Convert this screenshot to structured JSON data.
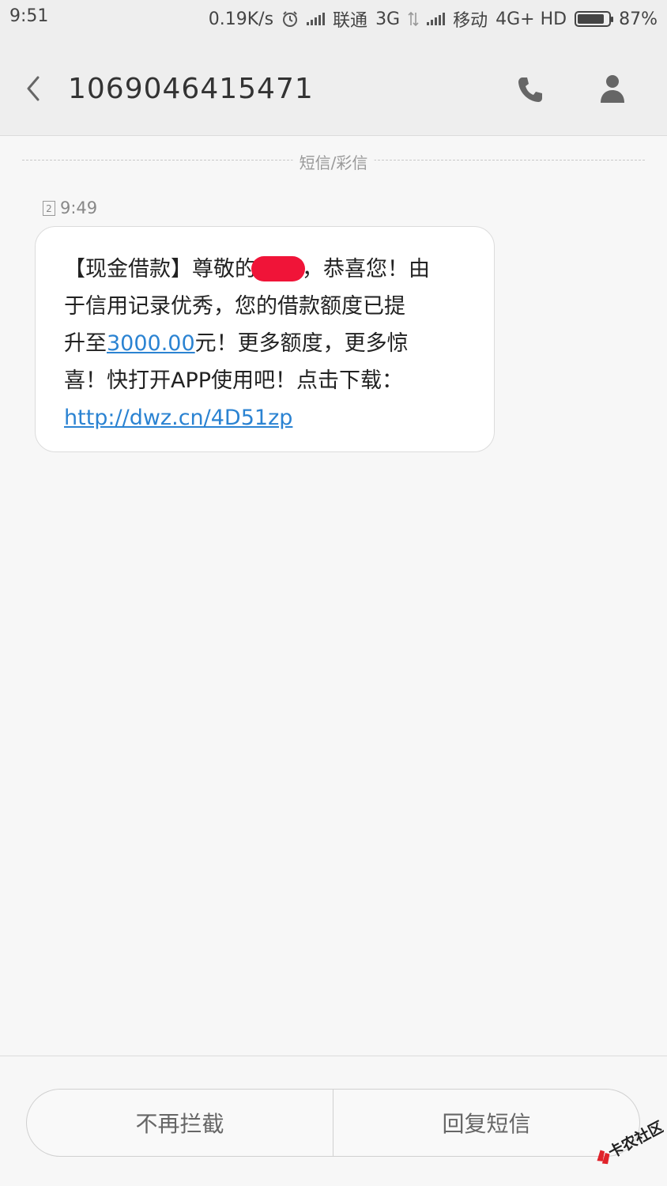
{
  "status_bar": {
    "time": "9:51",
    "speed": "0.19K/s",
    "carrier1": "联通",
    "net1": "3G",
    "carrier2": "移动",
    "net2": "4G+ HD",
    "battery_pct": "87%",
    "battery_level": 0.87
  },
  "header": {
    "title": "1069046415471"
  },
  "divider_label": "短信/彩信",
  "message": {
    "sim": "2",
    "time": "9:49",
    "line1_a": "【现金借款】尊敬的",
    "line1_b": "，恭喜您！由",
    "line2": "于信用记录优秀，您的借款额度已提",
    "line3_a": "升至",
    "line3_amount": "3000.00",
    "line3_b": "元！更多额度，更多惊",
    "line4": "喜！快打开APP使用吧！点击下载：",
    "link": "http://dwz.cn/4D51zp"
  },
  "actions": {
    "left_label": "不再拦截",
    "right_label": "回复短信"
  },
  "watermark_text": "卡农社区",
  "colors": {
    "link": "#2b83d2",
    "redaction": "#f01438",
    "background": "#f7f7f7"
  }
}
